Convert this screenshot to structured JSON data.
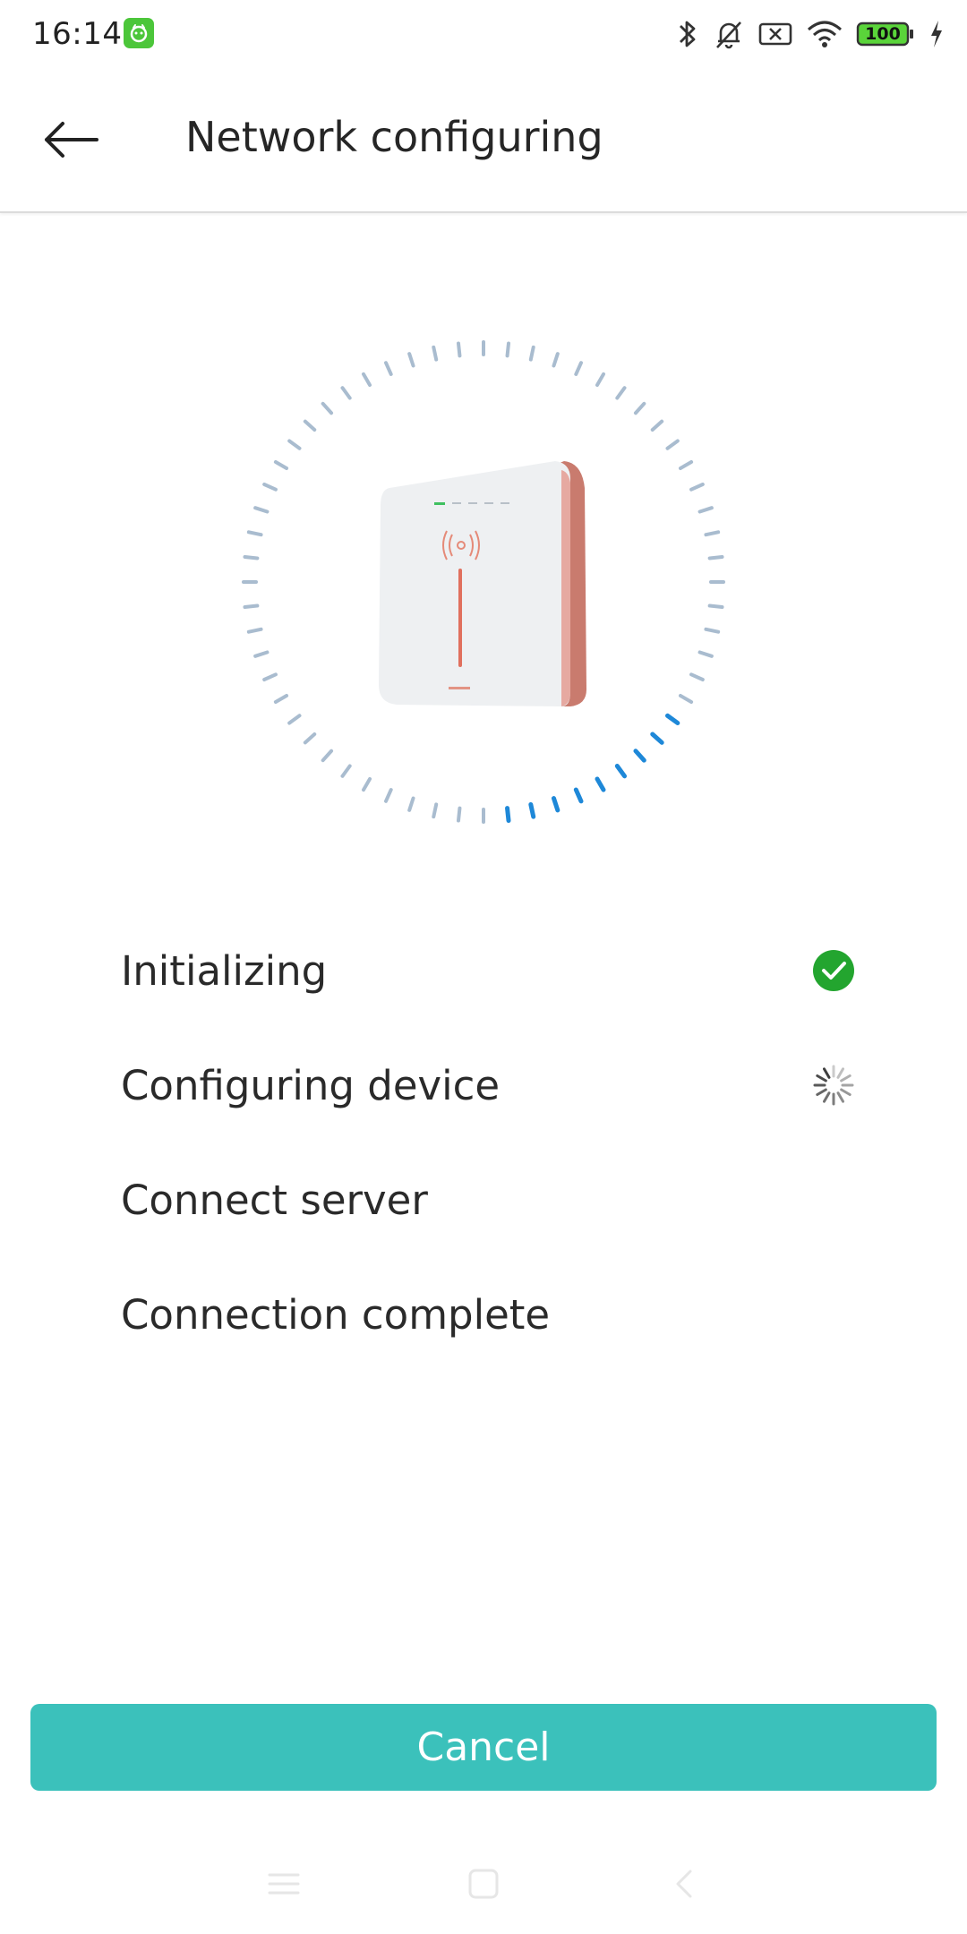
{
  "status_bar": {
    "time": "16:14",
    "battery_level": "100",
    "icons": [
      "app-notification-icon",
      "bluetooth-icon",
      "silent-icon",
      "sim-x-icon",
      "wifi-icon",
      "battery-icon",
      "charging-icon"
    ]
  },
  "header": {
    "back_icon": "back-arrow-icon",
    "title": "Network configuring"
  },
  "progress_ring": {
    "ticks_total": 60,
    "ticks_highlighted": 9,
    "highlight_color": "#1e88d8",
    "base_color": "#a9bccf"
  },
  "steps": [
    {
      "label": "Initializing",
      "status": "done"
    },
    {
      "label": "Configuring device",
      "status": "loading"
    },
    {
      "label": "Connect server",
      "status": "pending"
    },
    {
      "label": "Connection complete",
      "status": "pending"
    }
  ],
  "cancel_button": {
    "label": "Cancel",
    "color": "#3bc1bb"
  },
  "nav_bar": {
    "items": [
      "menu-icon",
      "home-icon",
      "back-icon"
    ]
  }
}
